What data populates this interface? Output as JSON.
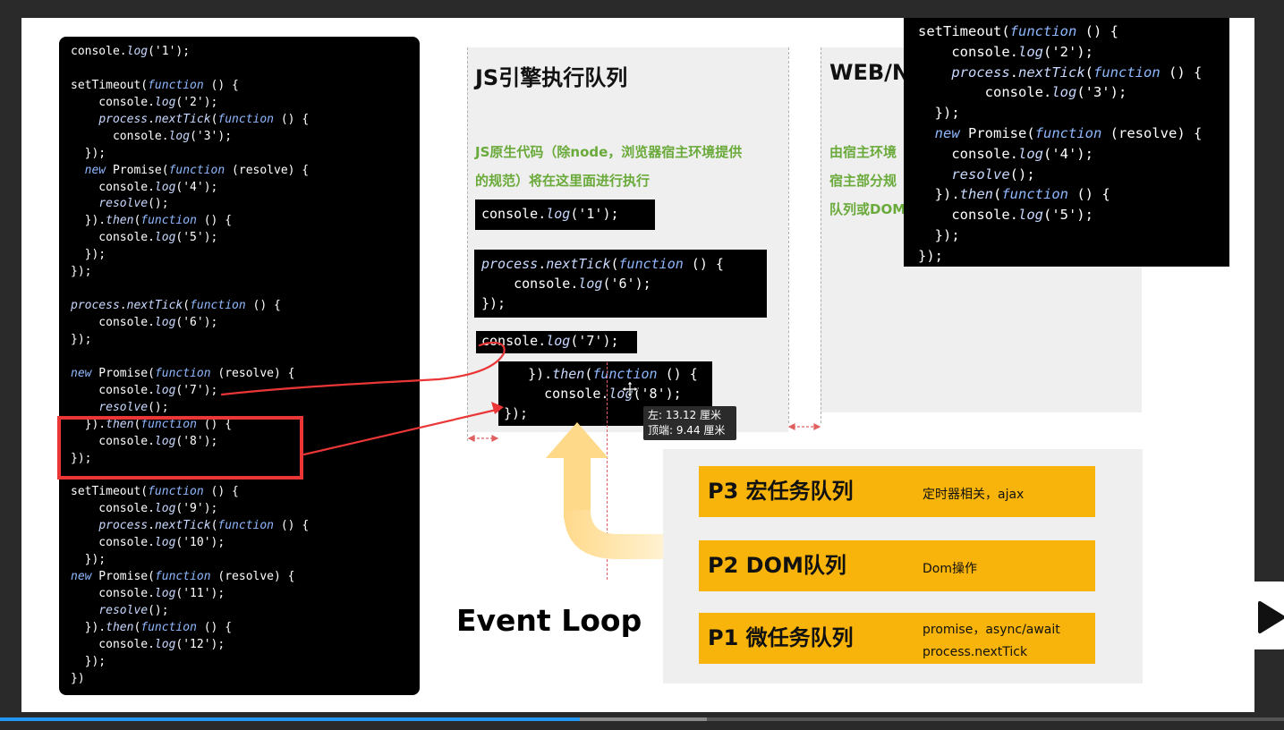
{
  "left_code": [
    [
      [
        "plain",
        "console"
      ],
      [
        "plain",
        "."
      ],
      [
        "fn",
        "log"
      ],
      [
        "plain",
        "('1');"
      ]
    ],
    [],
    [
      [
        "plain",
        "setTimeout("
      ],
      [
        "kw",
        "function"
      ],
      [
        "plain",
        " () {"
      ]
    ],
    [
      [
        "plain",
        "    console."
      ],
      [
        "fn",
        "log"
      ],
      [
        "plain",
        "('2');"
      ]
    ],
    [
      [
        "plain",
        "    "
      ],
      [
        "fn",
        "process"
      ],
      [
        "plain",
        "."
      ],
      [
        "fn",
        "nextTick"
      ],
      [
        "plain",
        "("
      ],
      [
        "kw",
        "function"
      ],
      [
        "plain",
        " () {"
      ]
    ],
    [
      [
        "plain",
        "      console."
      ],
      [
        "fn",
        "log"
      ],
      [
        "plain",
        "('3');"
      ]
    ],
    [
      [
        "plain",
        "  });"
      ]
    ],
    [
      [
        "plain",
        "  "
      ],
      [
        "kw",
        "new"
      ],
      [
        "plain",
        " Promise("
      ],
      [
        "kw",
        "function"
      ],
      [
        "plain",
        " (resolve) {"
      ]
    ],
    [
      [
        "plain",
        "    console."
      ],
      [
        "fn",
        "log"
      ],
      [
        "plain",
        "('4');"
      ]
    ],
    [
      [
        "plain",
        "    "
      ],
      [
        "fn",
        "resolve"
      ],
      [
        "plain",
        "();"
      ]
    ],
    [
      [
        "plain",
        "  })."
      ],
      [
        "fn",
        "then"
      ],
      [
        "plain",
        "("
      ],
      [
        "kw",
        "function"
      ],
      [
        "plain",
        " () {"
      ]
    ],
    [
      [
        "plain",
        "    console."
      ],
      [
        "fn",
        "log"
      ],
      [
        "plain",
        "('5');"
      ]
    ],
    [
      [
        "plain",
        "  });"
      ]
    ],
    [
      [
        "plain",
        "});"
      ]
    ],
    [],
    [
      [
        "fn",
        "process"
      ],
      [
        "plain",
        "."
      ],
      [
        "fn",
        "nextTick"
      ],
      [
        "plain",
        "("
      ],
      [
        "kw",
        "function"
      ],
      [
        "plain",
        " () {"
      ]
    ],
    [
      [
        "plain",
        "    console."
      ],
      [
        "fn",
        "log"
      ],
      [
        "plain",
        "('6');"
      ]
    ],
    [
      [
        "plain",
        "});"
      ]
    ],
    [],
    [
      [
        "kw",
        "new"
      ],
      [
        "plain",
        " Promise("
      ],
      [
        "kw",
        "function"
      ],
      [
        "plain",
        " (resolve) {"
      ]
    ],
    [
      [
        "plain",
        "    console."
      ],
      [
        "fn",
        "log"
      ],
      [
        "plain",
        "('7');"
      ]
    ],
    [
      [
        "plain",
        "    "
      ],
      [
        "fn",
        "resolve"
      ],
      [
        "plain",
        "();"
      ]
    ],
    [
      [
        "plain",
        "  })."
      ],
      [
        "fn",
        "then"
      ],
      [
        "plain",
        "("
      ],
      [
        "kw",
        "function"
      ],
      [
        "plain",
        " () {"
      ]
    ],
    [
      [
        "plain",
        "    console."
      ],
      [
        "fn",
        "log"
      ],
      [
        "plain",
        "('8');"
      ]
    ],
    [
      [
        "plain",
        "});"
      ]
    ],
    [],
    [
      [
        "plain",
        "setTimeout("
      ],
      [
        "kw",
        "function"
      ],
      [
        "plain",
        " () {"
      ]
    ],
    [
      [
        "plain",
        "    console."
      ],
      [
        "fn",
        "log"
      ],
      [
        "plain",
        "('9');"
      ]
    ],
    [
      [
        "plain",
        "    "
      ],
      [
        "fn",
        "process"
      ],
      [
        "plain",
        "."
      ],
      [
        "fn",
        "nextTick"
      ],
      [
        "plain",
        "("
      ],
      [
        "kw",
        "function"
      ],
      [
        "plain",
        " () {"
      ]
    ],
    [
      [
        "plain",
        "    console."
      ],
      [
        "fn",
        "log"
      ],
      [
        "plain",
        "('10');"
      ]
    ],
    [
      [
        "plain",
        "  });"
      ]
    ],
    [
      [
        "kw",
        "new"
      ],
      [
        "plain",
        " Promise("
      ],
      [
        "kw",
        "function"
      ],
      [
        "plain",
        " (resolve) {"
      ]
    ],
    [
      [
        "plain",
        "    console."
      ],
      [
        "fn",
        "log"
      ],
      [
        "plain",
        "('11');"
      ]
    ],
    [
      [
        "plain",
        "    "
      ],
      [
        "fn",
        "resolve"
      ],
      [
        "plain",
        "();"
      ]
    ],
    [
      [
        "plain",
        "  })."
      ],
      [
        "fn",
        "then"
      ],
      [
        "plain",
        "("
      ],
      [
        "kw",
        "function"
      ],
      [
        "plain",
        " () {"
      ]
    ],
    [
      [
        "plain",
        "    console."
      ],
      [
        "fn",
        "log"
      ],
      [
        "plain",
        "('12');"
      ]
    ],
    [
      [
        "plain",
        "  });"
      ]
    ],
    [
      [
        "plain",
        "})"
      ]
    ]
  ],
  "js_column": {
    "title": "JS引擎执行队列",
    "desc_line1": "JS原生代码（除node，浏览器宿主环境提供",
    "desc_line2": "的规范）将在这里面进行执行"
  },
  "web_column": {
    "title": "WEB/N",
    "desc_line1": "由宿主环境",
    "desc_line2": "宿主部分规",
    "desc_line3": "队列或DOM"
  },
  "snippets": {
    "log1": [
      [
        [
          "plain",
          "console."
        ],
        [
          "fn",
          "log"
        ],
        [
          "plain",
          "('1');"
        ]
      ]
    ],
    "tick6": [
      [
        [
          "fn",
          "process"
        ],
        [
          "plain",
          "."
        ],
        [
          "fn",
          "nextTick"
        ],
        [
          "plain",
          "("
        ],
        [
          "kw",
          "function"
        ],
        [
          "plain",
          " () {"
        ]
      ],
      [
        [
          "plain",
          "    console."
        ],
        [
          "fn",
          "log"
        ],
        [
          "plain",
          "('6');"
        ]
      ],
      [
        [
          "plain",
          "});"
        ]
      ]
    ],
    "log7": [
      [
        [
          "plain",
          "console."
        ],
        [
          "fn",
          "log"
        ],
        [
          "plain",
          "('7');"
        ]
      ]
    ],
    "then8": [
      [
        [
          "plain",
          "   })."
        ],
        [
          "fn",
          "then"
        ],
        [
          "plain",
          "("
        ],
        [
          "kw",
          "function"
        ],
        [
          "plain",
          " () {"
        ]
      ],
      [
        [
          "plain",
          "     console."
        ],
        [
          "fn",
          "log"
        ],
        [
          "plain",
          "('8');"
        ]
      ],
      [
        [
          "plain",
          "});"
        ]
      ]
    ]
  },
  "big_code": [
    [
      [
        "plain",
        "setTimeout("
      ],
      [
        "kw",
        "function"
      ],
      [
        "plain",
        " () {"
      ]
    ],
    [
      [
        "plain",
        "    console."
      ],
      [
        "fn",
        "log"
      ],
      [
        "plain",
        "('2');"
      ]
    ],
    [
      [
        "plain",
        "    "
      ],
      [
        "fn",
        "process"
      ],
      [
        "plain",
        "."
      ],
      [
        "fn",
        "nextTick"
      ],
      [
        "plain",
        "("
      ],
      [
        "kw",
        "function"
      ],
      [
        "plain",
        " () {"
      ]
    ],
    [
      [
        "plain",
        "        console."
      ],
      [
        "fn",
        "log"
      ],
      [
        "plain",
        "('3');"
      ]
    ],
    [
      [
        "plain",
        "  });"
      ]
    ],
    [
      [
        "plain",
        "  "
      ],
      [
        "kw",
        "new"
      ],
      [
        "plain",
        " Promise("
      ],
      [
        "kw",
        "function"
      ],
      [
        "plain",
        " (resolve) {"
      ]
    ],
    [
      [
        "plain",
        "    console."
      ],
      [
        "fn",
        "log"
      ],
      [
        "plain",
        "('4');"
      ]
    ],
    [
      [
        "plain",
        "    "
      ],
      [
        "fn",
        "resolve"
      ],
      [
        "plain",
        "();"
      ]
    ],
    [
      [
        "plain",
        "  })."
      ],
      [
        "fn",
        "then"
      ],
      [
        "plain",
        "("
      ],
      [
        "kw",
        "function"
      ],
      [
        "plain",
        " () {"
      ]
    ],
    [
      [
        "plain",
        "    console."
      ],
      [
        "fn",
        "log"
      ],
      [
        "plain",
        "('5');"
      ]
    ],
    [
      [
        "plain",
        "  });"
      ]
    ],
    [
      [
        "plain",
        "});"
      ]
    ]
  ],
  "queues": {
    "p3": {
      "name": "P3 宏任务队列",
      "note": "定时器相关，ajax"
    },
    "p2": {
      "name": "P2 DOM队列",
      "note": "Dom操作"
    },
    "p1": {
      "name": "P1 微任务队列",
      "note_line1": "promise，async/await",
      "note_line2": "process.nextTick"
    }
  },
  "event_loop": "Event Loop",
  "tooltip": {
    "left": "左: 13.12 厘米",
    "top": "顶端: 9.44 厘米"
  },
  "video": {
    "progress_played": 0.4516,
    "progress_buffered": 0.5505
  },
  "colors": {
    "queue_fill": "#f8b40a",
    "desc_green": "#6aaa3a",
    "annotation_red": "#ea3636",
    "progress_blue": "#2196f3"
  }
}
